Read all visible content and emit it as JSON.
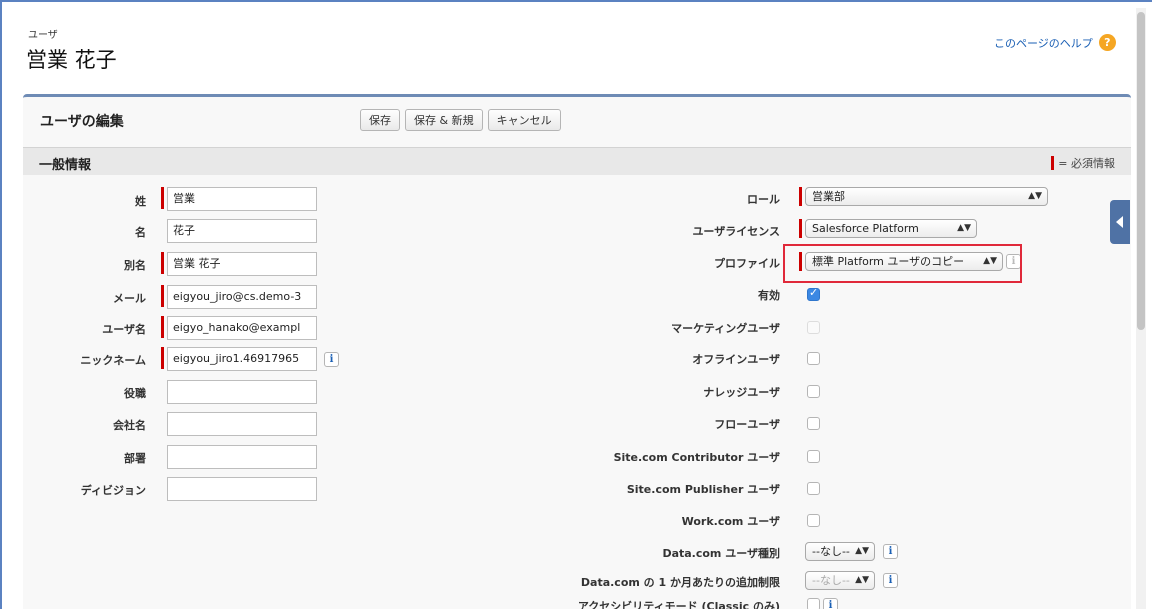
{
  "header": {
    "object_type": "ユーザ",
    "record_name": "営業 花子",
    "help_link": "このページのヘルプ",
    "help_icon": "question-mark-icon"
  },
  "panel": {
    "title": "ユーザの編集",
    "buttons": {
      "save": "保存",
      "save_new": "保存 & 新規",
      "cancel": "キャンセル"
    }
  },
  "section": {
    "title": "一般情報",
    "required_legend": "= 必須情報"
  },
  "left_fields": {
    "last_name": {
      "label": "姓",
      "value": "営業",
      "required": true
    },
    "first_name": {
      "label": "名",
      "value": "花子",
      "required": false
    },
    "alias": {
      "label": "別名",
      "value": "営業 花子",
      "required": true
    },
    "email": {
      "label": "メール",
      "value": "eigyou_jiro@cs.demo-3",
      "required": true
    },
    "username": {
      "label": "ユーザ名",
      "value": "eigyo_hanako@exampl",
      "required": true
    },
    "nickname": {
      "label": "ニックネーム",
      "value": "eigyou_jiro1.46917965",
      "required": true
    },
    "title": {
      "label": "役職",
      "value": ""
    },
    "company": {
      "label": "会社名",
      "value": ""
    },
    "department": {
      "label": "部署",
      "value": ""
    },
    "division": {
      "label": "ディビジョン",
      "value": ""
    }
  },
  "right_fields": {
    "role": {
      "label": "ロール",
      "value": "営業部"
    },
    "license": {
      "label": "ユーザライセンス",
      "value": "Salesforce Platform"
    },
    "profile": {
      "label": "プロファイル",
      "value": "標準 Platform ユーザのコピー"
    },
    "active": {
      "label": "有効",
      "checked": true
    },
    "marketing_user": {
      "label": "マーケティングユーザ",
      "checked": false,
      "disabled": true
    },
    "offline_user": {
      "label": "オフラインユーザ",
      "checked": false
    },
    "knowledge_user": {
      "label": "ナレッジユーザ",
      "checked": false
    },
    "flow_user": {
      "label": "フローユーザ",
      "checked": false
    },
    "site_contributor": {
      "label": "Site.com Contributor ユーザ",
      "checked": false
    },
    "site_publisher": {
      "label": "Site.com Publisher ユーザ",
      "checked": false
    },
    "work_user": {
      "label": "Work.com ユーザ",
      "checked": false
    },
    "datacom_type": {
      "label": "Data.com ユーザ種別",
      "value": "--なし--"
    },
    "datacom_limit": {
      "label": "Data.com の 1 か月あたりの追加制限",
      "value": "--なし--"
    },
    "accessibility": {
      "label": "アクセシビリティモード (Classic のみ)",
      "checked": false
    }
  },
  "info_icon_label": "i"
}
